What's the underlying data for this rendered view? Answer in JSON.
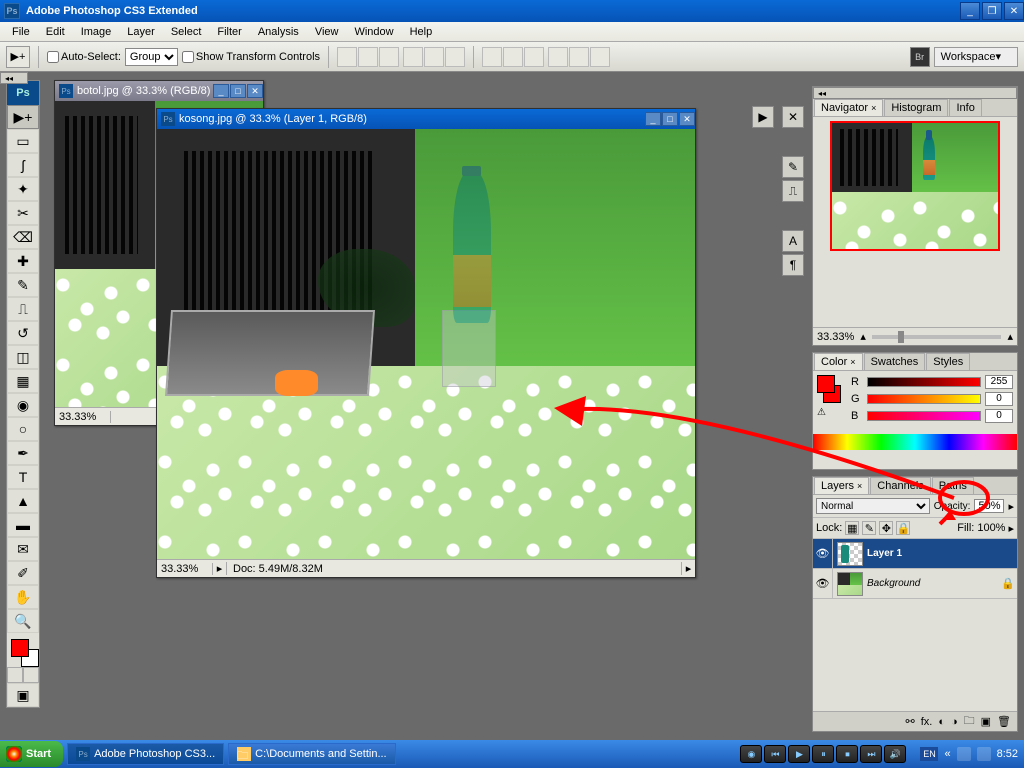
{
  "app": {
    "title": "Adobe Photoshop CS3 Extended"
  },
  "menu": [
    "File",
    "Edit",
    "Image",
    "Layer",
    "Select",
    "Filter",
    "Analysis",
    "View",
    "Window",
    "Help"
  ],
  "options": {
    "auto_select": "Auto-Select:",
    "group": "Group",
    "transform": "Show Transform Controls",
    "workspace": "Workspace"
  },
  "docs": {
    "back": {
      "title": "botol.jpg @ 33.3% (RGB/8)",
      "zoom": "33.33%"
    },
    "front": {
      "title": "kosong.jpg @ 33.3% (Layer 1, RGB/8)",
      "zoom": "33.33%",
      "docinfo": "Doc: 5.49M/8.32M"
    }
  },
  "panels": {
    "navigator": {
      "tabs": [
        "Navigator",
        "Histogram",
        "Info"
      ],
      "zoom": "33.33%"
    },
    "color": {
      "tabs": [
        "Color",
        "Swatches",
        "Styles"
      ],
      "r": "255",
      "g": "0",
      "b": "0"
    },
    "layers": {
      "tabs": [
        "Layers",
        "Channels",
        "Paths"
      ],
      "blend": "Normal",
      "opacity_label": "Opacity:",
      "opacity": "50%",
      "lock_label": "Lock:",
      "fill_label": "Fill:",
      "fill": "100%",
      "rows": [
        {
          "name": "Layer 1"
        },
        {
          "name": "Background"
        }
      ]
    }
  },
  "taskbar": {
    "start": "Start",
    "tasks": [
      "Adobe Photoshop CS3...",
      "C:\\Documents and Settin..."
    ],
    "lang": "EN",
    "time": "8:52"
  }
}
